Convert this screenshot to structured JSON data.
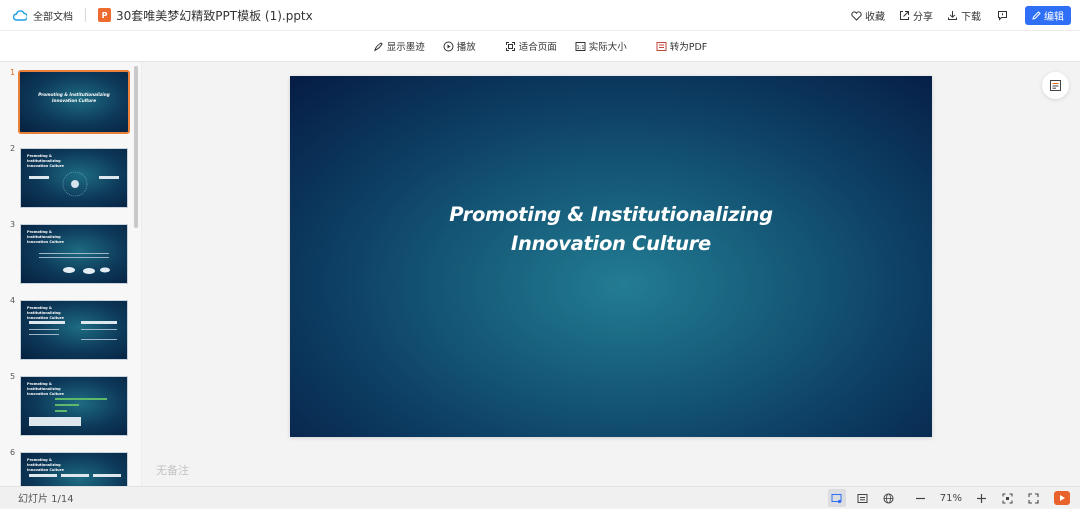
{
  "topbar": {
    "all_docs": "全部文档",
    "file_icon_letter": "P",
    "filename": "30套唯美梦幻精致PPT模板 (1).pptx",
    "actions": [
      "收藏",
      "分享",
      "下载"
    ],
    "edit_label": "编辑"
  },
  "toolbar": {
    "show_ink": "显示墨迹",
    "play": "播放",
    "fit_page": "适合页面",
    "actual_size": "实际大小",
    "to_pdf": "转为PDF"
  },
  "thumbnails": [
    {
      "num": "1",
      "active": true
    },
    {
      "num": "2",
      "active": false,
      "title": "Promoting & Institutionalizing Innovation Culture"
    },
    {
      "num": "3",
      "active": false,
      "title": "Promoting & Institutionalizing Innovation Culture"
    },
    {
      "num": "4",
      "active": false,
      "title": "Promoting & Institutionalizing Innovation Culture"
    },
    {
      "num": "5",
      "active": false,
      "title": "Promoting & Institutionalizing Innovation Culture"
    },
    {
      "num": "6",
      "active": false,
      "title": "Promoting & Institutionalizing Innovation Culture"
    }
  ],
  "slide": {
    "title_line1": "Promoting & Institutionalizing",
    "title_line2": "Innovation Culture"
  },
  "notes_placeholder": "无备注",
  "status": {
    "slide_count": "幻灯片 1/14",
    "zoom": "71%"
  },
  "colors": {
    "accent": "#2f6ff5",
    "ppt_icon": "#ee6b2f",
    "active_thumb": "#e9803a"
  }
}
